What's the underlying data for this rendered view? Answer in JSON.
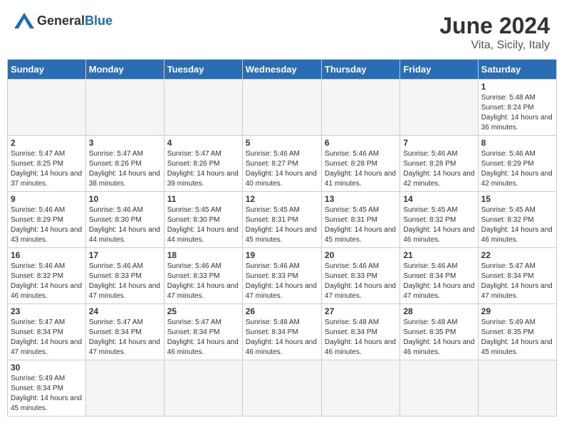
{
  "header": {
    "logo_general": "General",
    "logo_blue": "Blue",
    "title": "June 2024",
    "subtitle": "Vita, Sicily, Italy"
  },
  "days_of_week": [
    "Sunday",
    "Monday",
    "Tuesday",
    "Wednesday",
    "Thursday",
    "Friday",
    "Saturday"
  ],
  "weeks": [
    [
      {
        "day": "",
        "info": ""
      },
      {
        "day": "",
        "info": ""
      },
      {
        "day": "",
        "info": ""
      },
      {
        "day": "",
        "info": ""
      },
      {
        "day": "",
        "info": ""
      },
      {
        "day": "",
        "info": ""
      },
      {
        "day": "1",
        "info": "Sunrise: 5:48 AM\nSunset: 8:24 PM\nDaylight: 14 hours and 36 minutes."
      }
    ],
    [
      {
        "day": "2",
        "info": "Sunrise: 5:47 AM\nSunset: 8:25 PM\nDaylight: 14 hours and 37 minutes."
      },
      {
        "day": "3",
        "info": "Sunrise: 5:47 AM\nSunset: 8:26 PM\nDaylight: 14 hours and 38 minutes."
      },
      {
        "day": "4",
        "info": "Sunrise: 5:47 AM\nSunset: 8:26 PM\nDaylight: 14 hours and 39 minutes."
      },
      {
        "day": "5",
        "info": "Sunrise: 5:46 AM\nSunset: 8:27 PM\nDaylight: 14 hours and 40 minutes."
      },
      {
        "day": "6",
        "info": "Sunrise: 5:46 AM\nSunset: 8:28 PM\nDaylight: 14 hours and 41 minutes."
      },
      {
        "day": "7",
        "info": "Sunrise: 5:46 AM\nSunset: 8:28 PM\nDaylight: 14 hours and 42 minutes."
      },
      {
        "day": "8",
        "info": "Sunrise: 5:46 AM\nSunset: 8:29 PM\nDaylight: 14 hours and 42 minutes."
      }
    ],
    [
      {
        "day": "9",
        "info": "Sunrise: 5:46 AM\nSunset: 8:29 PM\nDaylight: 14 hours and 43 minutes."
      },
      {
        "day": "10",
        "info": "Sunrise: 5:46 AM\nSunset: 8:30 PM\nDaylight: 14 hours and 44 minutes."
      },
      {
        "day": "11",
        "info": "Sunrise: 5:45 AM\nSunset: 8:30 PM\nDaylight: 14 hours and 44 minutes."
      },
      {
        "day": "12",
        "info": "Sunrise: 5:45 AM\nSunset: 8:31 PM\nDaylight: 14 hours and 45 minutes."
      },
      {
        "day": "13",
        "info": "Sunrise: 5:45 AM\nSunset: 8:31 PM\nDaylight: 14 hours and 45 minutes."
      },
      {
        "day": "14",
        "info": "Sunrise: 5:45 AM\nSunset: 8:32 PM\nDaylight: 14 hours and 46 minutes."
      },
      {
        "day": "15",
        "info": "Sunrise: 5:45 AM\nSunset: 8:32 PM\nDaylight: 14 hours and 46 minutes."
      }
    ],
    [
      {
        "day": "16",
        "info": "Sunrise: 5:46 AM\nSunset: 8:32 PM\nDaylight: 14 hours and 46 minutes."
      },
      {
        "day": "17",
        "info": "Sunrise: 5:46 AM\nSunset: 8:33 PM\nDaylight: 14 hours and 47 minutes."
      },
      {
        "day": "18",
        "info": "Sunrise: 5:46 AM\nSunset: 8:33 PM\nDaylight: 14 hours and 47 minutes."
      },
      {
        "day": "19",
        "info": "Sunrise: 5:46 AM\nSunset: 8:33 PM\nDaylight: 14 hours and 47 minutes."
      },
      {
        "day": "20",
        "info": "Sunrise: 5:46 AM\nSunset: 8:33 PM\nDaylight: 14 hours and 47 minutes."
      },
      {
        "day": "21",
        "info": "Sunrise: 5:46 AM\nSunset: 8:34 PM\nDaylight: 14 hours and 47 minutes."
      },
      {
        "day": "22",
        "info": "Sunrise: 5:47 AM\nSunset: 8:34 PM\nDaylight: 14 hours and 47 minutes."
      }
    ],
    [
      {
        "day": "23",
        "info": "Sunrise: 5:47 AM\nSunset: 8:34 PM\nDaylight: 14 hours and 47 minutes."
      },
      {
        "day": "24",
        "info": "Sunrise: 5:47 AM\nSunset: 8:34 PM\nDaylight: 14 hours and 47 minutes."
      },
      {
        "day": "25",
        "info": "Sunrise: 5:47 AM\nSunset: 8:34 PM\nDaylight: 14 hours and 46 minutes."
      },
      {
        "day": "26",
        "info": "Sunrise: 5:48 AM\nSunset: 8:34 PM\nDaylight: 14 hours and 46 minutes."
      },
      {
        "day": "27",
        "info": "Sunrise: 5:48 AM\nSunset: 8:34 PM\nDaylight: 14 hours and 46 minutes."
      },
      {
        "day": "28",
        "info": "Sunrise: 5:48 AM\nSunset: 8:35 PM\nDaylight: 14 hours and 46 minutes."
      },
      {
        "day": "29",
        "info": "Sunrise: 5:49 AM\nSunset: 8:35 PM\nDaylight: 14 hours and 45 minutes."
      }
    ],
    [
      {
        "day": "30",
        "info": "Sunrise: 5:49 AM\nSunset: 8:34 PM\nDaylight: 14 hours and 45 minutes."
      },
      {
        "day": "",
        "info": ""
      },
      {
        "day": "",
        "info": ""
      },
      {
        "day": "",
        "info": ""
      },
      {
        "day": "",
        "info": ""
      },
      {
        "day": "",
        "info": ""
      },
      {
        "day": "",
        "info": ""
      }
    ]
  ]
}
